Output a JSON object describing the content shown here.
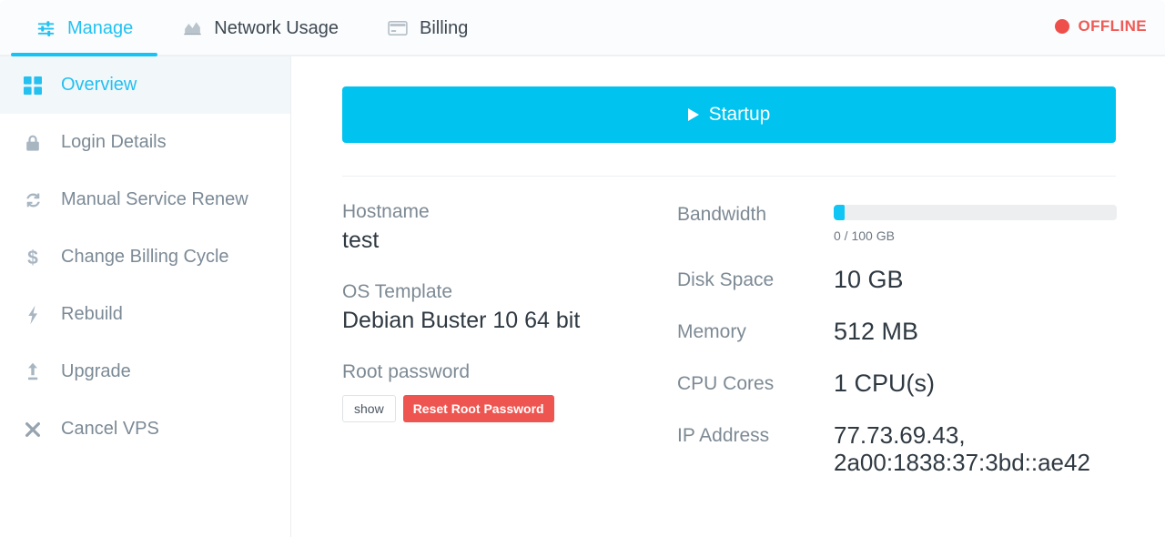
{
  "tabs": [
    {
      "label": "Manage",
      "icon": "sliders-icon",
      "active": true
    },
    {
      "label": "Network Usage",
      "icon": "area-chart-icon",
      "active": false
    },
    {
      "label": "Billing",
      "icon": "credit-card-icon",
      "active": false
    }
  ],
  "status": {
    "label": "OFFLINE",
    "color": "#ee4f4a",
    "dot": "status-dot-offline"
  },
  "sidebar": {
    "items": [
      {
        "label": "Overview",
        "icon": "grid-icon",
        "active": true
      },
      {
        "label": "Login Details",
        "icon": "lock-icon",
        "active": false
      },
      {
        "label": "Manual Service Renew",
        "icon": "refresh-icon",
        "active": false
      },
      {
        "label": "Change Billing Cycle",
        "icon": "dollar-icon",
        "active": false
      },
      {
        "label": "Rebuild",
        "icon": "bolt-icon",
        "active": false
      },
      {
        "label": "Upgrade",
        "icon": "arrow-up-icon",
        "active": false
      },
      {
        "label": "Cancel VPS",
        "icon": "close-x-icon",
        "active": false
      }
    ]
  },
  "main": {
    "startup_button": {
      "label": "Startup",
      "icon": "play-icon",
      "color": "#00c3f0"
    },
    "left_fields": [
      {
        "label": "Hostname",
        "value": "test"
      },
      {
        "label": "OS Template",
        "value": "Debian Buster 10 64 bit"
      }
    ],
    "root_password": {
      "label": "Root password",
      "show_label": "show",
      "reset_label": "Reset Root Password",
      "reset_color": "#ef5550"
    },
    "bandwidth": {
      "label": "Bandwidth",
      "used_text": "0 / 100 GB",
      "used": 0,
      "total": 100,
      "unit": "GB",
      "fill_percent": 4,
      "fill_color": "#11c5f4",
      "track_color": "#eceef0"
    },
    "specs": [
      {
        "label": "Disk Space",
        "value": "10 GB"
      },
      {
        "label": "Memory",
        "value": "512 MB"
      },
      {
        "label": "CPU Cores",
        "value": "1 CPU(s)"
      },
      {
        "label": "IP Address",
        "value": "77.73.69.43, 2a00:1838:37:3bd::ae42"
      }
    ]
  }
}
